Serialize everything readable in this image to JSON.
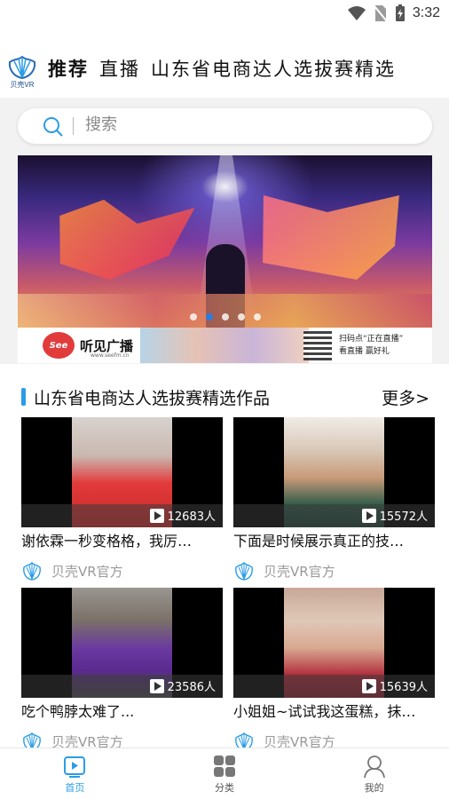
{
  "status_bar": {
    "time": "3:32",
    "icons": [
      "wifi-icon",
      "no-sim-icon",
      "battery-charging-icon"
    ]
  },
  "header": {
    "logo_text": "贝壳VR",
    "tabs": [
      {
        "label": "推荐",
        "active": true
      },
      {
        "label": "直播",
        "active": false
      },
      {
        "label": "山东省电商达人选拔赛精选",
        "active": false
      }
    ]
  },
  "search": {
    "placeholder": "搜索"
  },
  "banner": {
    "slides": 5,
    "active_slide": 2
  },
  "ad": {
    "logo_text": "See",
    "name": "听见广播",
    "url": "www.seefm.cn",
    "qr_text_line1": "扫码点“正在直播”",
    "qr_text_line2": "看直播 赢好礼"
  },
  "section": {
    "title": "山东省电商达人选拔赛精选作品",
    "more": "更多>"
  },
  "videos": [
    {
      "title": "谢依霖一秒变格格，我厉…",
      "views": "12683人",
      "author": "贝壳VR官方"
    },
    {
      "title": "下面是时候展示真正的技…",
      "views": "15572人",
      "author": "贝壳VR官方"
    },
    {
      "title": "吃个鸭脖太难了...",
      "views": "23586人",
      "author": "贝壳VR官方"
    },
    {
      "title": "小姐姐~试试我这蛋糕，抹…",
      "views": "15639人",
      "author": "贝壳VR官方"
    }
  ],
  "bottom_nav": [
    {
      "label": "首页",
      "icon": "home-icon",
      "active": true
    },
    {
      "label": "分类",
      "icon": "category-icon",
      "active": false
    },
    {
      "label": "我的",
      "icon": "profile-icon",
      "active": false
    }
  ],
  "colors": {
    "accent": "#2a9ce8",
    "logo": "#1a4a8a"
  }
}
